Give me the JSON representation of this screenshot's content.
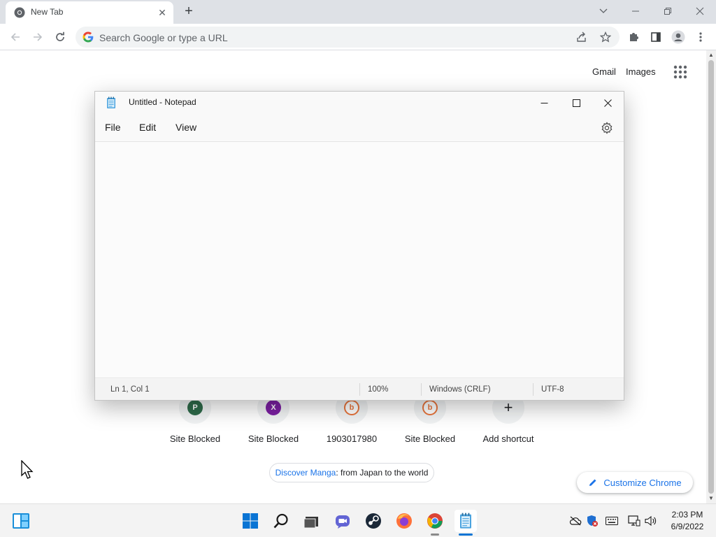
{
  "browser": {
    "tab": {
      "title": "New Tab",
      "close_glyph": "✕"
    },
    "new_tab_glyph": "+",
    "omnibox": {
      "placeholder": "Search Google or type a URL"
    }
  },
  "ntp": {
    "header_links": {
      "gmail": "Gmail",
      "images": "Images"
    },
    "shortcuts": [
      {
        "label": "Site Blocked",
        "badge": "P",
        "badge_color": "#2e6b4a"
      },
      {
        "label": "Site Blocked",
        "badge": "X",
        "badge_color": "#7b1fa2"
      },
      {
        "label": "1903017980",
        "badge": "b",
        "badge_color": "#e8743b"
      },
      {
        "label": "Site Blocked",
        "badge": "b",
        "badge_color": "#e8743b"
      },
      {
        "label": "Add shortcut",
        "badge": "+",
        "badge_color": "#f1f3f4"
      }
    ],
    "promo": {
      "link_text": "Discover Manga",
      "rest_text": ": from Japan to the world"
    },
    "customize_label": "Customize Chrome"
  },
  "notepad": {
    "title": "Untitled - Notepad",
    "menus": [
      "File",
      "Edit",
      "View"
    ],
    "content": "",
    "status": {
      "position": "Ln 1, Col 1",
      "zoom": "100%",
      "line_ending": "Windows (CRLF)",
      "encoding": "UTF-8"
    }
  },
  "taskbar": {
    "clock": {
      "time": "2:03 PM",
      "date": "6/9/2022"
    },
    "pinned_icons": [
      "windows-start-icon",
      "search-icon",
      "task-view-icon",
      "chat-icon",
      "steam-icon",
      "firefox-icon",
      "chrome-icon",
      "notepad-icon"
    ]
  },
  "colors": {
    "chrome_frame": "#dee1e6",
    "accent_blue": "#1a73e8",
    "taskbar": "#f3f3f3"
  }
}
